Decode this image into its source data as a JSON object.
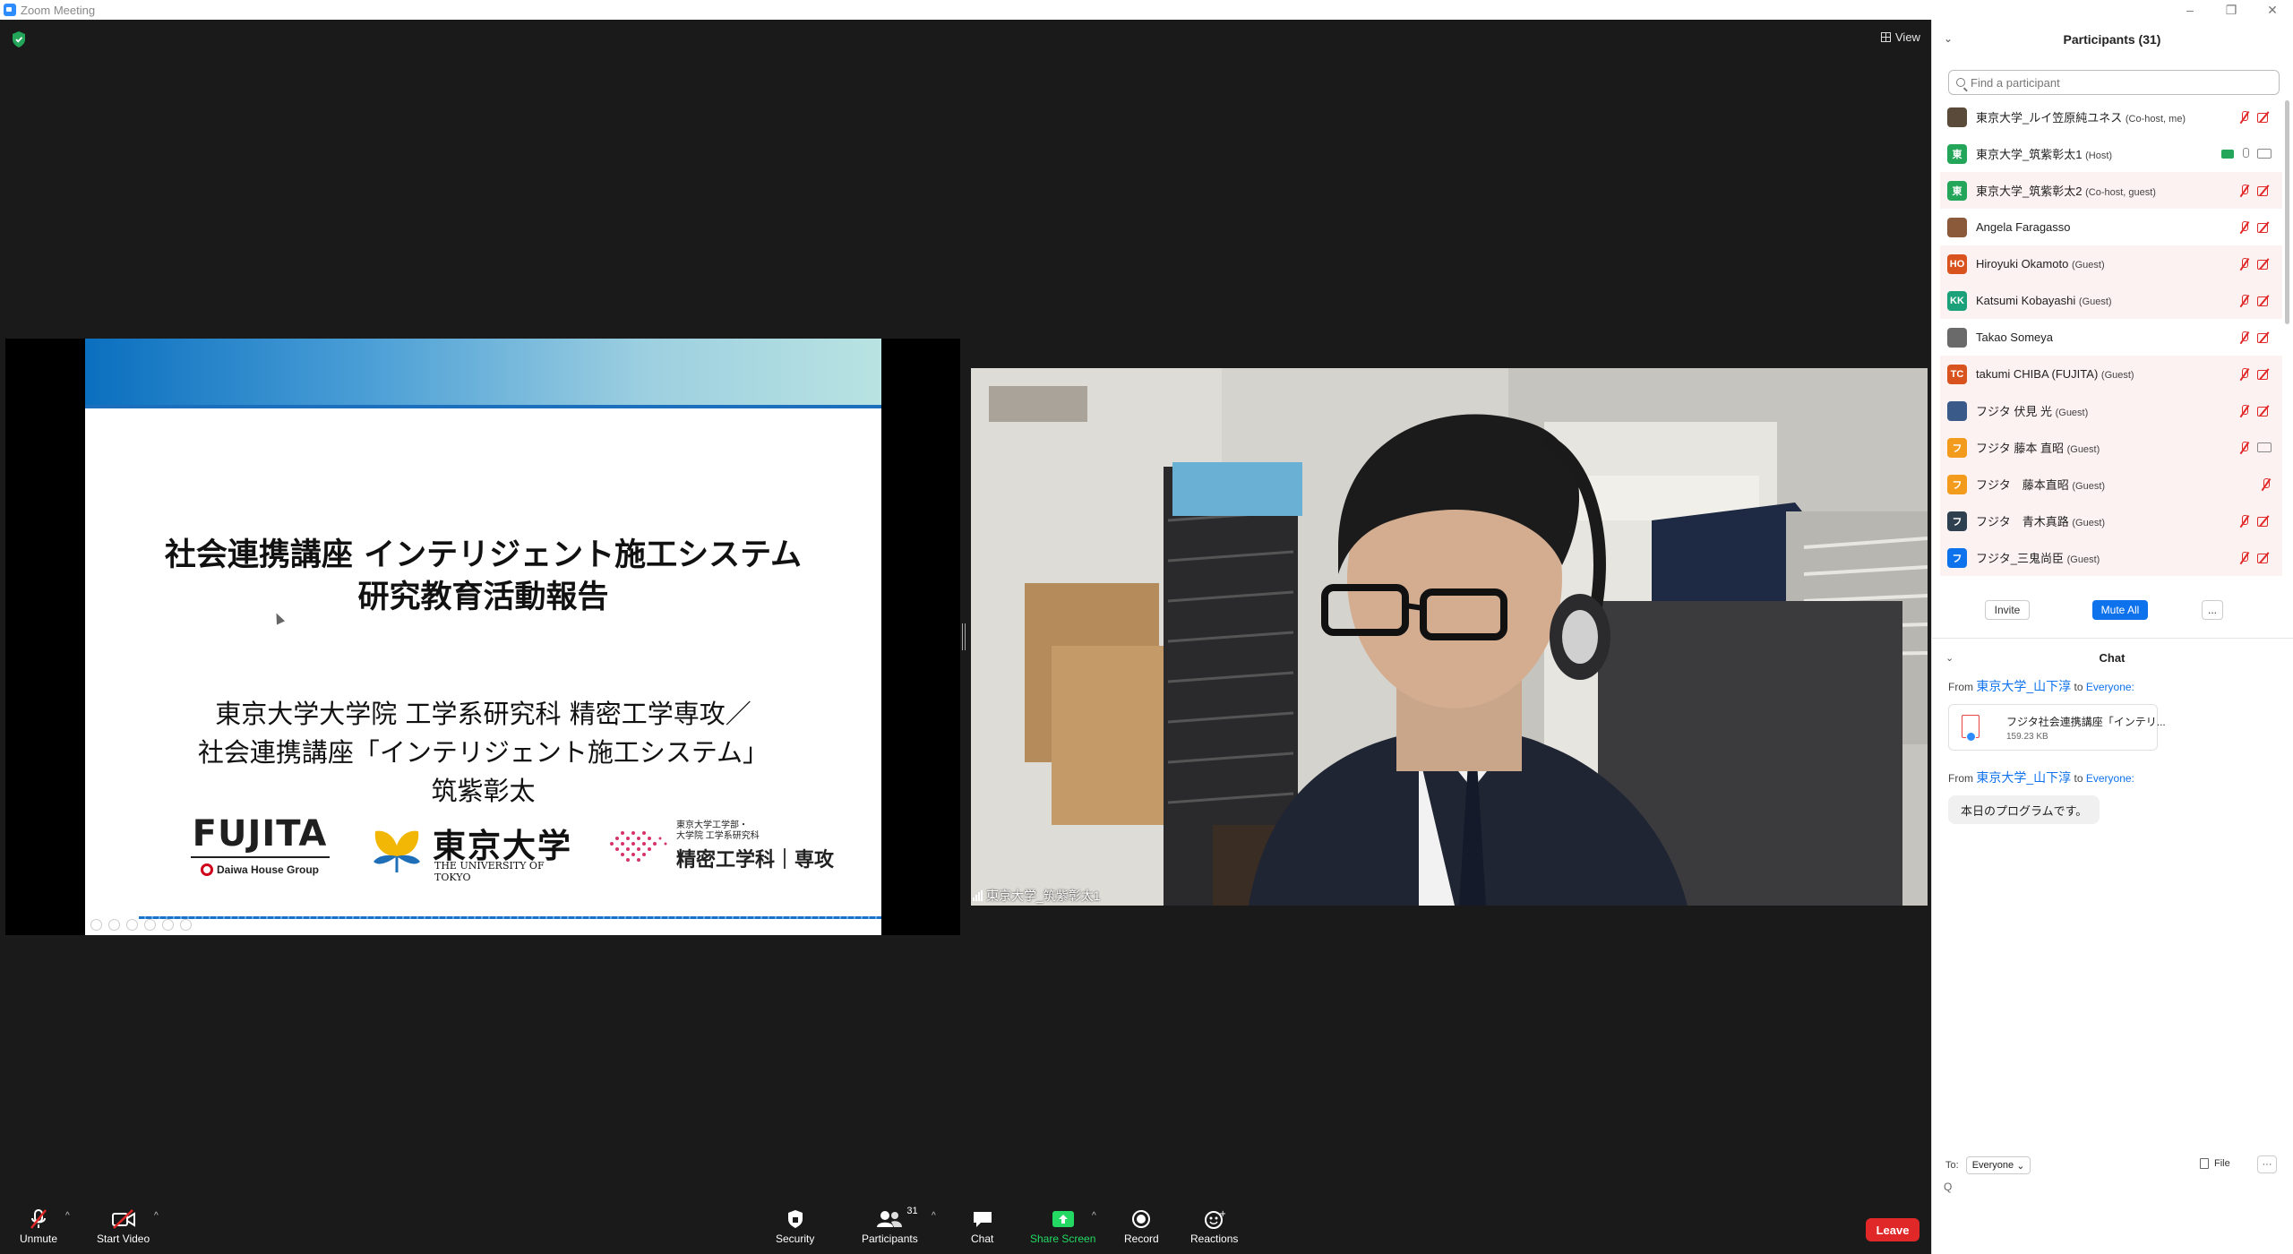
{
  "window": {
    "title": "Zoom Meeting"
  },
  "stage": {
    "view_label": "View"
  },
  "slide": {
    "title_line1": "社会連携講座 インテリジェント施工システム",
    "title_line2": "研究教育活動報告",
    "sub_line1": "東京大学大学院 工学系研究科 精密工学専攻／",
    "sub_line2": "社会連携講座「インテリジェント施工システム」",
    "sub_line3": "筑紫彰太",
    "logo_fujita": "FUJITA",
    "logo_daiwa": "Daiwa House Group",
    "logo_todai": "東京大学",
    "logo_todai_en": "THE UNIVERSITY OF TOKYO",
    "logo_dept_small1": "東京大学工学部・",
    "logo_dept_small2": "大学院 工学系研究科",
    "logo_dept_big": "精密工学科｜専攻"
  },
  "video": {
    "name": "東京大学_筑紫彰太1"
  },
  "toolbar": {
    "unmute": "Unmute",
    "start_video": "Start Video",
    "security": "Security",
    "participants": "Participants",
    "participants_count": "31",
    "chat": "Chat",
    "share_screen": "Share Screen",
    "record": "Record",
    "reactions": "Reactions",
    "leave": "Leave"
  },
  "participants_panel": {
    "title": "Participants (31)",
    "search_placeholder": "Find a participant",
    "items": [
      {
        "initials": "",
        "color": "#5a4a3a",
        "name": "東京大学_ルイ笠原純ユネス",
        "tag": "(Co-host, me)",
        "mic": "off",
        "cam": "off",
        "highlight": false
      },
      {
        "initials": "東",
        "color": "#23a55a",
        "name": "東京大学_筑紫彰太1",
        "tag": "(Host)",
        "mic": "on",
        "cam": "on",
        "sharing": true,
        "highlight": false
      },
      {
        "initials": "東",
        "color": "#23a55a",
        "name": "東京大学_筑紫彰太2",
        "tag": "(Co-host, guest)",
        "mic": "off",
        "cam": "off",
        "highlight": true
      },
      {
        "initials": "",
        "color": "#8a5a3a",
        "name": "Angela Faragasso",
        "tag": "",
        "mic": "off",
        "cam": "off",
        "highlight": false
      },
      {
        "initials": "HO",
        "color": "#d9531e",
        "name": "Hiroyuki Okamoto",
        "tag": "(Guest)",
        "mic": "off",
        "cam": "off",
        "highlight": true
      },
      {
        "initials": "KK",
        "color": "#1aa17a",
        "name": "Katsumi Kobayashi",
        "tag": "(Guest)",
        "mic": "off",
        "cam": "off",
        "highlight": true
      },
      {
        "initials": "",
        "color": "#6a6a6a",
        "name": "Takao Someya",
        "tag": "",
        "mic": "off",
        "cam": "off",
        "highlight": false
      },
      {
        "initials": "TC",
        "color": "#d9531e",
        "name": "takumi CHIBA (FUJITA)",
        "tag": "(Guest)",
        "mic": "off",
        "cam": "off",
        "highlight": true
      },
      {
        "initials": "",
        "color": "#3a5a8a",
        "name": "フジタ 伏見 光",
        "tag": "(Guest)",
        "mic": "off",
        "cam": "off",
        "highlight": true
      },
      {
        "initials": "フ",
        "color": "#f29b1d",
        "name": "フジタ 藤本 直昭",
        "tag": "(Guest)",
        "mic": "off",
        "cam": "on",
        "highlight": true
      },
      {
        "initials": "フ",
        "color": "#f29b1d",
        "name": "フジタ　藤本直昭",
        "tag": "(Guest)",
        "mic": "off",
        "cam": "",
        "highlight": true
      },
      {
        "initials": "フ",
        "color": "#2e3f4f",
        "name": "フジタ　青木真路",
        "tag": "(Guest)",
        "mic": "off",
        "cam": "off",
        "highlight": true
      },
      {
        "initials": "フ",
        "color": "#0e72ed",
        "name": "フジタ_三鬼尚臣",
        "tag": "(Guest)",
        "mic": "off",
        "cam": "off",
        "highlight": true
      }
    ],
    "invite": "Invite",
    "mute_all": "Mute All",
    "more": "..."
  },
  "chat": {
    "title": "Chat",
    "messages": [
      {
        "from_prefix": "From",
        "sender": "東京大学_山下淳",
        "to_word": "to",
        "recipient": "Everyone:",
        "file_name": "フジタ社会連携講座「インテリ...",
        "file_size": "159.23 KB"
      },
      {
        "from_prefix": "From",
        "sender": "東京大学_山下淳",
        "to_word": "to",
        "recipient": "Everyone:",
        "text": "本日のプログラムです。"
      }
    ],
    "to_label": "To:",
    "to_value": "Everyone",
    "file_label": "File",
    "more": "···",
    "input_placeholder": "Q"
  },
  "colors": {
    "accent": "#0e72ed",
    "leave": "#e02828",
    "share": "#23d963",
    "muted": "#e02828"
  }
}
